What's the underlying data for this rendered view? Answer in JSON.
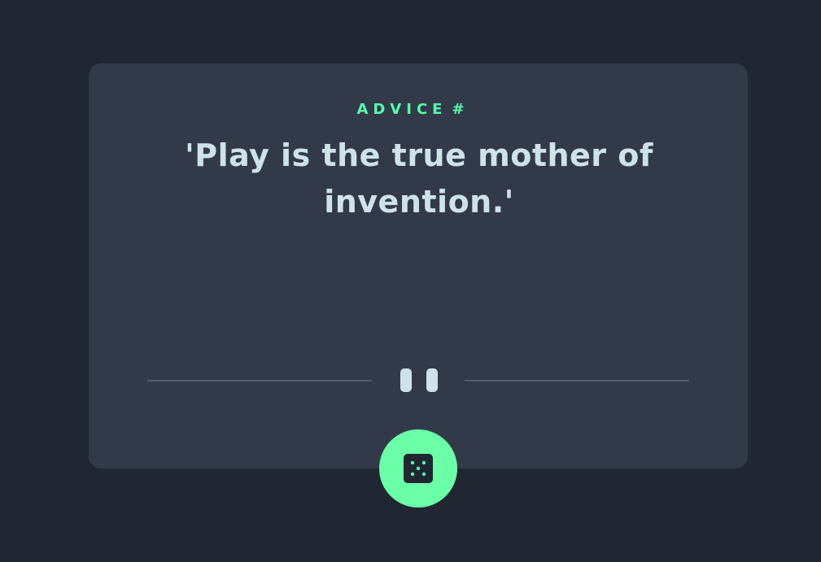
{
  "advice": {
    "label": "ADVICE",
    "hash": "#",
    "quote": "'Play is the true mother of invention.'"
  },
  "icons": {
    "divider": "pause-icon",
    "dice": "dice-icon"
  },
  "colors": {
    "background": "#202632",
    "card": "#323a49",
    "accent": "#53ffab",
    "text": "#cee3e9",
    "divider": "#4f5d74"
  }
}
